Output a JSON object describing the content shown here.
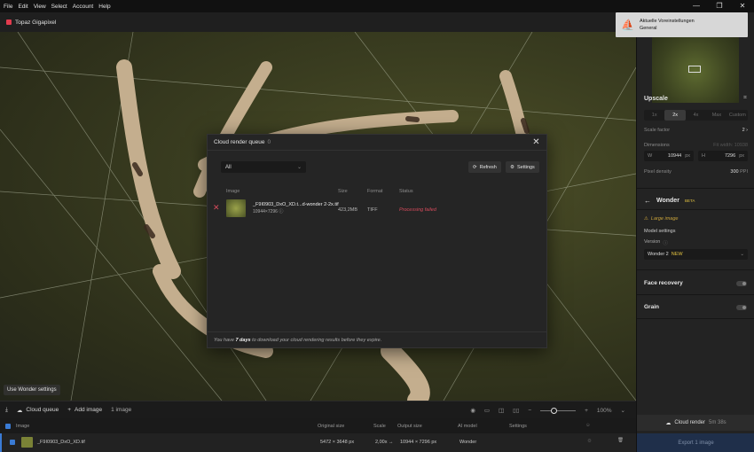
{
  "menu": [
    "File",
    "Edit",
    "View",
    "Select",
    "Account",
    "Help"
  ],
  "window_controls": [
    "—",
    "❐",
    "✕"
  ],
  "app": {
    "title": "Topaz Gigapixel"
  },
  "canvas": {
    "chip": "Use Wonder settings"
  },
  "bottombar": {
    "cloud_queue": "Cloud queue",
    "add_image": "Add image",
    "count": "1 image",
    "zoom": "100%"
  },
  "list": {
    "columns": {
      "image": "Image",
      "original_size": "Original size",
      "scale": "Scale",
      "output_size": "Output size",
      "ai_model": "AI model",
      "settings": "Settings"
    },
    "rows": [
      {
        "name": "_F9I0903_DxO_XD.tif",
        "original": "5472 × 3648 px",
        "scale": "2,00x →",
        "output": "10944 × 7296 px",
        "model": "Wonder"
      }
    ]
  },
  "toast": {
    "line1": "Aktuelle Voreinstellungen",
    "line2": "General"
  },
  "side": {
    "upscale": "Upscale",
    "scale_options": [
      "1x",
      "2x",
      "4x",
      "Max",
      "Custom"
    ],
    "scale_factor_label": "Scale factor",
    "scale_factor_value": "2",
    "dimensions_label": "Dimensions",
    "fit_label": "Fit width: 10938",
    "w_label": "W",
    "w_value": "10944",
    "h_label": "H",
    "h_value": "7296",
    "unit": "px",
    "pixel_density_label": "Pixel density",
    "pixel_density_value": "300",
    "density_unit": "PPI",
    "model_name": "Wonder",
    "model_badge": "BETA",
    "warning": "Large image",
    "model_settings": "Model settings",
    "version_label": "Version",
    "version_value": "Wonder 2",
    "version_badge": "NEW",
    "face_recovery": "Face recovery",
    "grain": "Grain",
    "cloud_render": "Cloud render",
    "cloud_render_time": "5m 38s",
    "export": "Export 1 image"
  },
  "modal": {
    "title": "Cloud render queue",
    "count": "0",
    "filter": "All",
    "refresh": "Refresh",
    "settings": "Settings",
    "columns": {
      "image": "Image",
      "size": "Size",
      "format": "Format",
      "status": "Status"
    },
    "row": {
      "name": "_F9I0903_DxO_XD.t...d-wonder 2-2x.tif",
      "dims": "10944×7296",
      "size": "423,2MB",
      "format": "TIFF",
      "status": "Processing failed"
    },
    "footer_pre": "You have",
    "footer_bold": "7 days",
    "footer_post": "to download your cloud rendering results before they expire."
  },
  "colors": {
    "accent": "#3a7bd5",
    "error": "#d64b5c",
    "new_badge": "#e0c040"
  }
}
